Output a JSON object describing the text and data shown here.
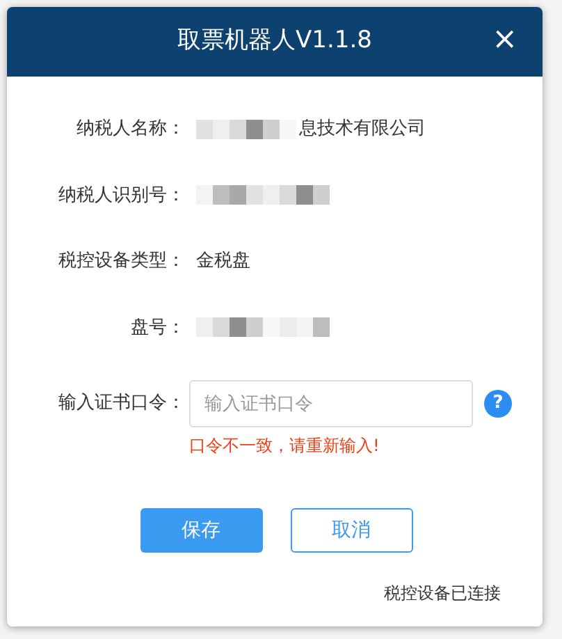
{
  "window": {
    "title": "取票机器人V1.1.8",
    "close": "×"
  },
  "fields": [
    {
      "kind": "text",
      "label": "纳税人名称：",
      "value": "息技术有限公司",
      "redacted": true
    },
    {
      "kind": "text",
      "label": "纳税人识别号：",
      "redacted": true
    },
    {
      "kind": "text",
      "label": "税控设备类型：",
      "value": "金税盘",
      "redacted": false
    },
    {
      "kind": "text",
      "label": "盘号：",
      "redacted": true
    },
    {
      "kind": "input",
      "label": "输入证书口令：",
      "placeholder": "输入证书口令",
      "help": "?",
      "error": "口令不一致，请重新输入!"
    }
  ],
  "buttons": [
    {
      "label": "保存",
      "primary": true
    },
    {
      "label": "取消",
      "primary": false
    }
  ],
  "status": "税控设备已连接"
}
